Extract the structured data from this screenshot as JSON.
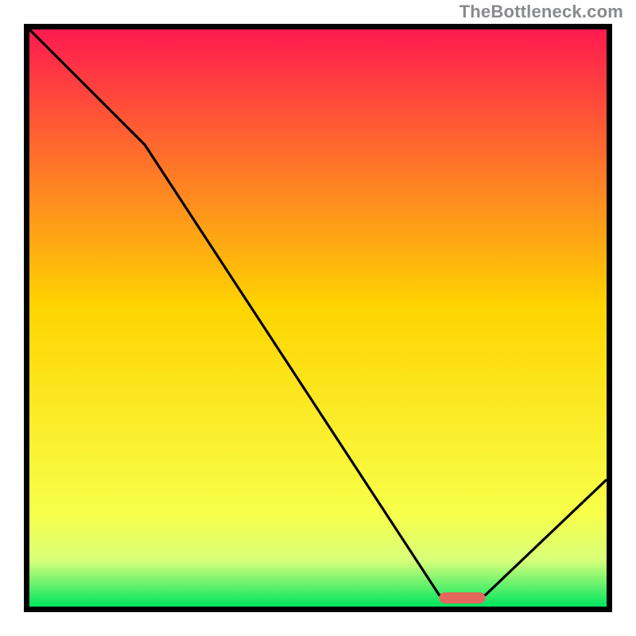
{
  "attribution": "TheBottleneck.com",
  "colors": {
    "frame": "#000000",
    "attribution_text": "#888a8c",
    "line": "#000000",
    "marker": "#e2685d",
    "grad_top": "#ff1a4f",
    "grad_mid": "#ffd400",
    "grad_low1": "#f7ff4a",
    "grad_low2": "#d8ff7a",
    "grad_bottom": "#00e55f"
  },
  "chart_data": {
    "type": "line",
    "title": "",
    "xlabel": "",
    "ylabel": "",
    "xlim": [
      0,
      100
    ],
    "ylim": [
      0,
      100
    ],
    "x": [
      0,
      20,
      71,
      75,
      79,
      100
    ],
    "values": [
      100,
      80,
      2.0,
      1.5,
      2.0,
      22
    ],
    "annotations": [
      {
        "type": "min-marker",
        "x_range": [
          71,
          79
        ],
        "y": 1.5
      }
    ],
    "background_gradient": {
      "stops": [
        {
          "pct": 0,
          "color_key": "grad_top"
        },
        {
          "pct": 48,
          "color_key": "grad_mid"
        },
        {
          "pct": 84,
          "color_key": "grad_low1"
        },
        {
          "pct": 92,
          "color_key": "grad_low2"
        },
        {
          "pct": 100,
          "color_key": "grad_bottom"
        }
      ]
    }
  }
}
